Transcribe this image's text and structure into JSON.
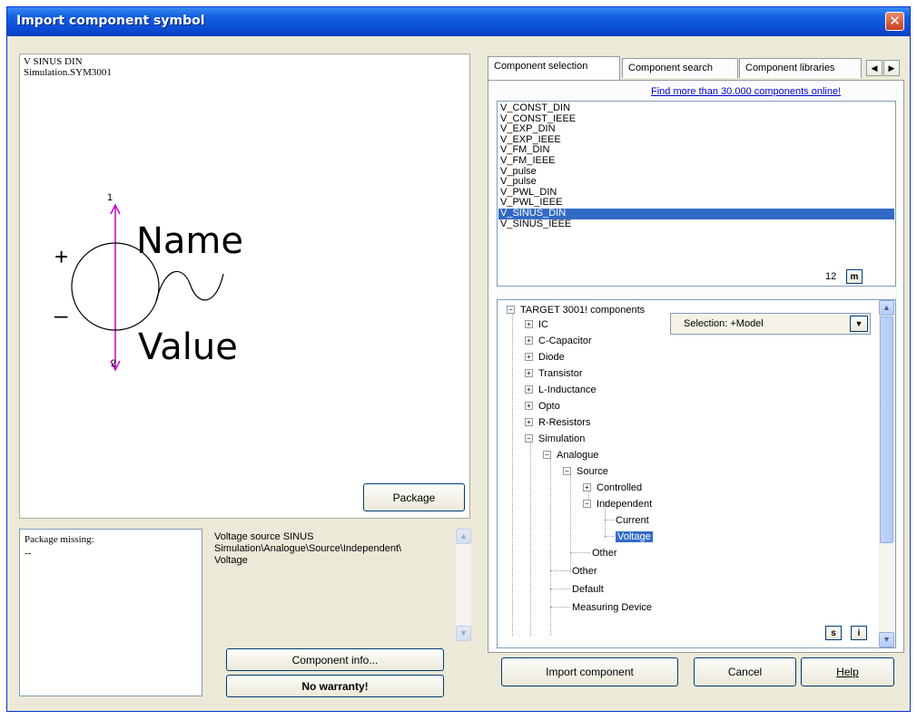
{
  "window": {
    "title": "Import component symbol",
    "close_glyph": "✕"
  },
  "preview": {
    "name_line1": "V SINUS DIN",
    "name_line2": "Simulation.SYM3001",
    "symbol_name": "Name",
    "symbol_value": "Value",
    "pin1": "1",
    "pin2": "2",
    "plus": "+",
    "minus": "–"
  },
  "package_button": "Package",
  "package_info": {
    "line1": "Package missing:",
    "line2": "--"
  },
  "description": {
    "line1": "Voltage source SINUS",
    "line2": "Simulation\\Analogue\\Source\\Independent\\",
    "line3": "Voltage"
  },
  "component_info_button": "Component info...",
  "no_warranty_label": "No warranty!",
  "tabs": {
    "items": [
      "Component selection",
      "Component search",
      "Component libraries"
    ],
    "prev_glyph": "◀",
    "next_glyph": "▶"
  },
  "online_link": "Find more than 30.000 components online!",
  "component_list": {
    "items": [
      "V_CONST_DIN",
      "V_CONST_IEEE",
      "V_EXP_DIN",
      "V_EXP_IEEE",
      "V_FM_DIN",
      "V_FM_IEEE",
      "V_pulse",
      "V_pulse",
      "V_PWL_DIN",
      "V_PWL_IEEE",
      "V_SINUS_DIN",
      "V_SINUS_IEEE"
    ],
    "selected_index": 10,
    "count": "12",
    "mode_button": "m"
  },
  "selection_combo": "Selection: +Model",
  "tree": {
    "root": "TARGET 3001! components",
    "items": [
      "IC",
      "C-Capacitor",
      "Diode",
      "Transistor",
      "L-Inductance",
      "Opto",
      "R-Resistors",
      "Simulation",
      "Analogue",
      "Source",
      "Controlled",
      "Independent",
      "Current",
      "Voltage",
      "Other",
      "Other",
      "Default",
      "Measuring Device"
    ],
    "btn_s": "s",
    "btn_i": "i"
  },
  "buttons": {
    "import": "Import component",
    "cancel": "Cancel",
    "help": "Help"
  },
  "colors": {
    "title_bar": "#0a4fd6",
    "selection": "#316ac5",
    "pin_color": "#c800c8"
  }
}
